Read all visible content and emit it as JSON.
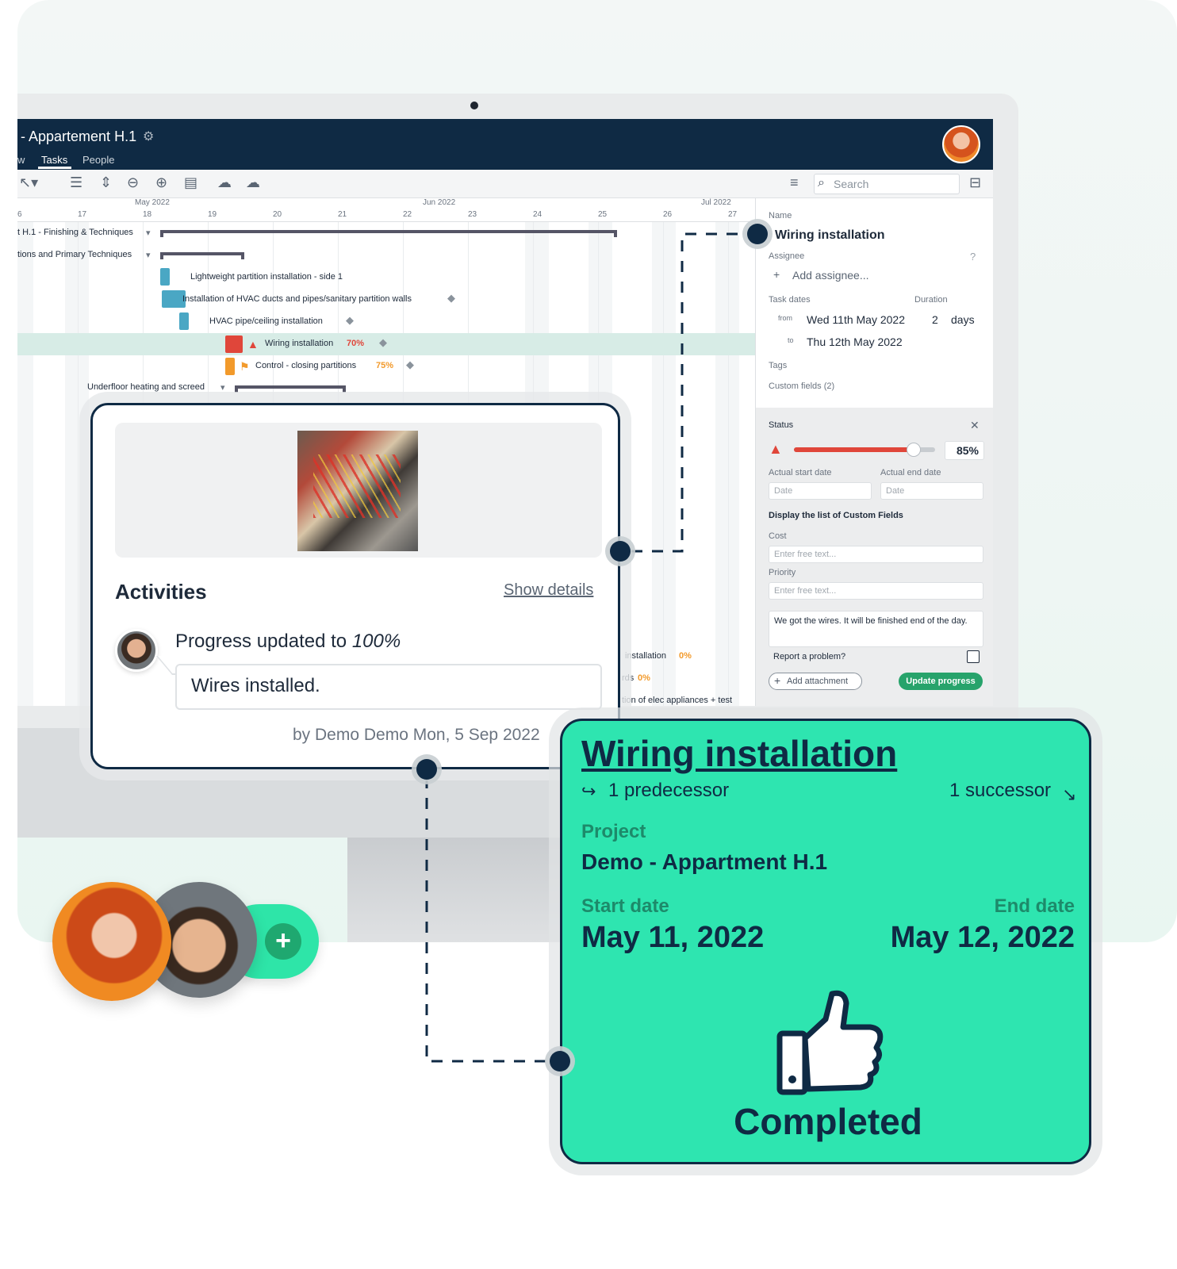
{
  "app": {
    "project_title": "- Appartement H.1",
    "tabs": [
      {
        "label": "w"
      },
      {
        "label": "Tasks"
      },
      {
        "label": "People"
      }
    ],
    "search_placeholder": "Search"
  },
  "timescale": {
    "months": [
      {
        "label": "May 2022"
      },
      {
        "label": "Jun 2022"
      },
      {
        "label": "Jul 2022"
      }
    ],
    "days": [
      "6",
      "17",
      "18",
      "19",
      "20",
      "21",
      "22",
      "23",
      "24",
      "25",
      "26",
      "27"
    ]
  },
  "gantt": {
    "rows": [
      {
        "label": "t H.1 - Finishing & Techniques"
      },
      {
        "label": "tions and Primary Techniques"
      },
      {
        "label": "Lightweight partition installation - side 1"
      },
      {
        "label": "Installation of HVAC ducts and pipes/sanitary partition walls"
      },
      {
        "label": "HVAC pipe/ceiling installation"
      },
      {
        "label": "Wiring installation",
        "progress": "70%"
      },
      {
        "label": "Control - closing partitions",
        "progress": "75%"
      },
      {
        "label": "Underfloor heating and screed"
      }
    ],
    "lower_rows": [
      {
        "label": "installation",
        "progress": "0%"
      },
      {
        "label": "rds",
        "progress": "0%"
      },
      {
        "label": "tion of elec appliances + test"
      }
    ]
  },
  "panel": {
    "name_label": "Name",
    "name_value": "Wiring installation",
    "assignee_label": "Assignee",
    "add_assignee": "Add assignee...",
    "task_dates_label": "Task dates",
    "duration_label": "Duration",
    "from_label": "from",
    "from_value": "Wed 11th May 2022",
    "to_label": "to",
    "to_value": "Thu 12th May 2022",
    "duration_value": "2",
    "duration_unit": "days",
    "tags_label": "Tags",
    "custom_fields_label": "Custom fields (2)",
    "status_label": "Status",
    "status_percent": "85",
    "status_percent_unit": "%",
    "status_fraction": 0.85,
    "actual_start_label": "Actual start date",
    "actual_end_label": "Actual end date",
    "date_placeholder": "Date",
    "custom_fields_title": "Display the list of Custom Fields",
    "cost_label": "Cost",
    "priority_label": "Priority",
    "free_text_placeholder": "Enter free text...",
    "comment_text": "We got the wires. It will be finished end of the day.",
    "report_problem_label": "Report a problem?",
    "add_attachment_label": "Add attachment",
    "update_progress_label": "Update progress"
  },
  "activities": {
    "title": "Activities",
    "show_details": "Show details",
    "progress_prefix": "Progress updated to ",
    "progress_value": "100%",
    "comment": "Wires installed.",
    "byline": "by Demo Demo Mon, 5 Sep 2022"
  },
  "card": {
    "title": "Wiring installation",
    "predecessor": "1 predecessor",
    "successor": "1 successor",
    "project_label": "Project",
    "project_value": "Demo - Appartment H.1",
    "start_label": "Start date",
    "start_value": "May 11, 2022",
    "end_label": "End date",
    "end_value": "May 12, 2022",
    "status_text": "Completed"
  },
  "colors": {
    "navy": "#0f2a44",
    "accent_green": "#2ee5b0",
    "button_green": "#27a36b",
    "warning_red": "#e0463a",
    "progress_orange": "#f29a2b"
  },
  "icons": [
    "gear-icon",
    "search-icon",
    "filter-icon",
    "zoom-out-icon",
    "zoom-in-icon",
    "cloud-download-icon",
    "cloud-upload-icon",
    "tag-icon",
    "warning-icon",
    "flag-icon",
    "help-icon",
    "close-icon",
    "plus-icon",
    "arrow-left-icon",
    "arrow-right-icon",
    "thumbs-up-icon"
  ]
}
